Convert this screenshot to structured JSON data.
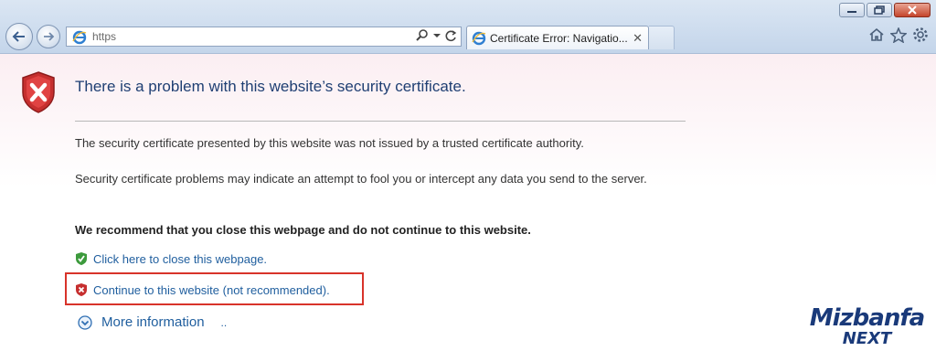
{
  "browser": {
    "address": "https",
    "tab_title": "Certificate Error: Navigatio...",
    "tab_close": "✕"
  },
  "page": {
    "title": "There is a problem with this website’s security certificate.",
    "paragraph1": "The security certificate presented by this website was not issued by a trusted certificate authority.",
    "paragraph2": "Security certificate problems may indicate an attempt to fool you or intercept any data you send to the server.",
    "recommendation": "We recommend that you close this webpage and do not continue to this website.",
    "close_link": "Click here to close this webpage.",
    "continue_link": "Continue to this website (not recommended).",
    "more_info": "More information",
    "more_info_dots": ".."
  },
  "watermark": {
    "brand": "Mizbanfa",
    "suffix": "NEXT"
  },
  "colors": {
    "title": "#1f3f73",
    "link": "#1f5e9e",
    "highlight": "#d8332a",
    "shield_red": "#c62f2f",
    "shield_green": "#3c9a3c"
  },
  "icons": [
    "back-arrow-icon",
    "forward-arrow-icon",
    "ie-icon",
    "search-icon",
    "dropdown-icon",
    "refresh-icon",
    "home-icon",
    "star-icon",
    "gear-icon",
    "error-shield-icon",
    "green-shield-icon",
    "red-shield-icon",
    "expand-icon"
  ]
}
